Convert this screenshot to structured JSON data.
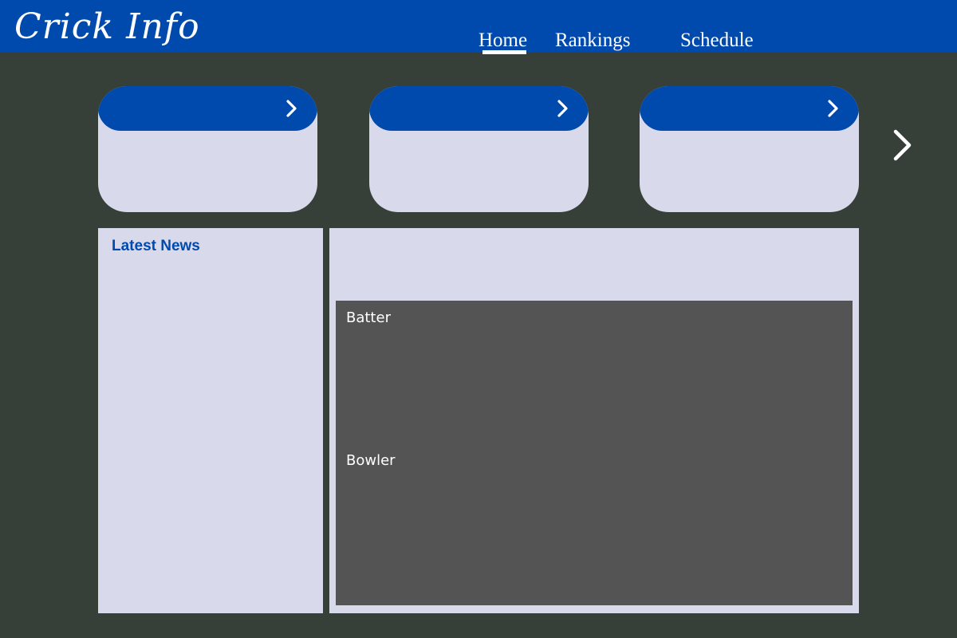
{
  "app": {
    "logo_text": "Crick Info"
  },
  "nav": {
    "items": [
      {
        "label": "Home",
        "active": true
      },
      {
        "label": "Rankings",
        "active": false
      },
      {
        "label": "Schedule",
        "active": false
      }
    ]
  },
  "match_cards": {
    "count_visible": 3,
    "card_icon": "chevron-right-icon",
    "next_icon": "chevron-right-icon"
  },
  "news": {
    "title": "Latest News"
  },
  "scorecard": {
    "batter_label": "Batter",
    "bowler_label": "Bowler"
  },
  "colors": {
    "primary": "#004aad",
    "background": "#363f38",
    "panel": "#d9d9ec",
    "scorecard": "#545454",
    "text_on_primary": "#ffffff"
  }
}
